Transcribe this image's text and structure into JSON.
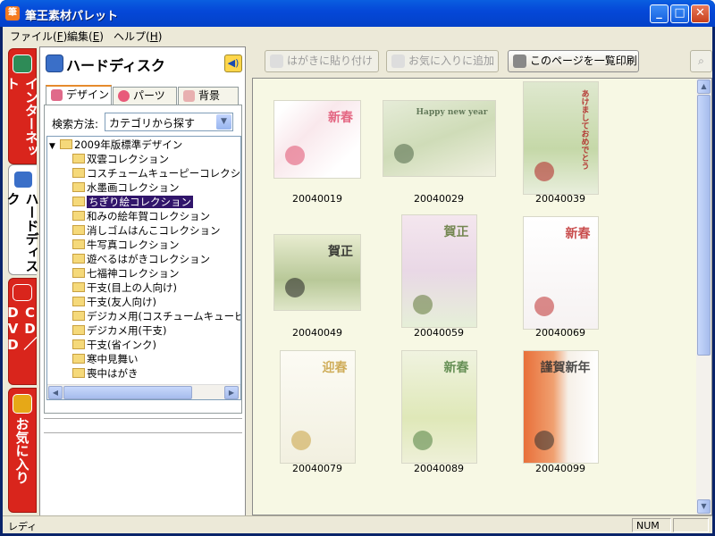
{
  "window": {
    "title": "筆王素材パレット",
    "icon": "筆"
  },
  "menu": [
    {
      "label": "ファイル(",
      "key": "F",
      "end": ")"
    },
    {
      "label": "編集(",
      "key": "E",
      "end": ")"
    },
    {
      "label": "ヘルプ(",
      "key": "H",
      "end": ")"
    }
  ],
  "side_tabs": [
    {
      "label": "インターネット",
      "icon": "internet-icon",
      "color": "#2e8b57"
    },
    {
      "label": "ハードディスク",
      "icon": "harddisk-icon",
      "color": "#3a6fc8"
    },
    {
      "label": "CD／DVD",
      "icon": "cd-icon",
      "color": "#d9251c"
    },
    {
      "label": "お気に入り",
      "icon": "star-icon",
      "color": "#e6a817"
    }
  ],
  "left": {
    "title": "ハードディスク",
    "tabs": [
      "デザイン",
      "パーツ",
      "背景"
    ],
    "search_label": "検索方法:",
    "search_value": "カテゴリから探す",
    "tree_root": "2009年版標準デザイン",
    "tree_items": [
      "双雲コレクション",
      "コスチュームキューピーコレクション",
      "水墨画コレクション",
      "ちぎり絵コレクション",
      "和みの絵年賀コレクション",
      "消しゴムはんこコレクション",
      "牛写真コレクション",
      "遊べるはがきコレクション",
      "七福神コレクション",
      "干支(目上の人向け)",
      "干支(友人向け)",
      "デジカメ用(コスチュームキューピーコ",
      "デジカメ用(干支)",
      "干支(省インク)",
      "寒中見舞い",
      "喪中はがき"
    ],
    "selected_index": 3
  },
  "toolbar": {
    "paste": "はがきに貼り付け",
    "favorite": "お気に入りに追加",
    "print": "このページを一覧印刷"
  },
  "thumbnails": [
    {
      "caption": "20040019",
      "text": "新春"
    },
    {
      "caption": "20040029",
      "text": "Happy new year"
    },
    {
      "caption": "20040039",
      "text": "あけましておめでとう"
    },
    {
      "caption": "20040049",
      "text": "賀正"
    },
    {
      "caption": "20040059",
      "text": "賀正"
    },
    {
      "caption": "20040069",
      "text": "新春"
    },
    {
      "caption": "20040079",
      "text": "迎春"
    },
    {
      "caption": "20040089",
      "text": "新春"
    },
    {
      "caption": "20040099",
      "text": "謹賀新年"
    }
  ],
  "status": {
    "left": "レディ",
    "num": "NUM"
  }
}
